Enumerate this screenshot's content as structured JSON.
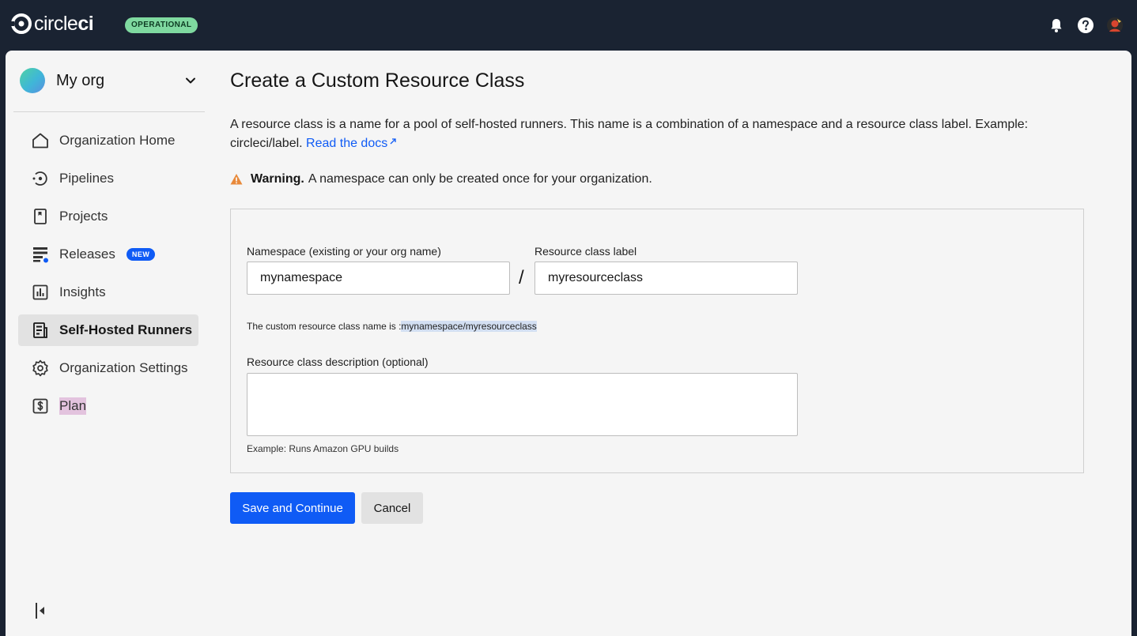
{
  "header": {
    "logo_text_plain": "circle",
    "logo_text_bold": "ci",
    "status_badge": "OPERATIONAL",
    "icons": [
      "bell-icon",
      "help-icon",
      "user-avatar"
    ]
  },
  "sidebar": {
    "org_name": "My org",
    "items": [
      {
        "label": "Organization Home",
        "icon": "home-icon"
      },
      {
        "label": "Pipelines",
        "icon": "pipelines-icon"
      },
      {
        "label": "Projects",
        "icon": "projects-icon"
      },
      {
        "label": "Releases",
        "icon": "releases-icon",
        "badge": "NEW"
      },
      {
        "label": "Insights",
        "icon": "insights-icon"
      },
      {
        "label": "Self-Hosted Runners",
        "icon": "runners-icon",
        "active": true
      },
      {
        "label": "Organization Settings",
        "icon": "gear-icon"
      },
      {
        "label": "Plan",
        "icon": "dollar-icon"
      }
    ]
  },
  "main": {
    "title": "Create a Custom Resource Class",
    "intro": "A resource class is a name for a pool of self-hosted runners. This name is a combination of a namespace and a resource class label. Example: circleci/label.",
    "docs_link": "Read the docs",
    "warning_bold": "Warning.",
    "warning_text": "A namespace can only be created once for your organization.",
    "form": {
      "namespace_label": "Namespace (existing or your org name)",
      "namespace_value": "mynamespace",
      "separator": "/",
      "label_label": "Resource class label",
      "label_value": "myresourceclass",
      "computed_prefix": "The custom resource class name is :",
      "computed_value": "mynamespace/myresourceclass",
      "description_label": "Resource class description (optional)",
      "description_value": "",
      "description_example": "Example: Runs Amazon GPU builds"
    },
    "save_button": "Save and Continue",
    "cancel_button": "Cancel"
  },
  "colors": {
    "header_bg": "#1a2332",
    "primary": "#0f5bf5",
    "operational_badge": "#7fd9a0",
    "warning_icon": "#e8893a"
  }
}
